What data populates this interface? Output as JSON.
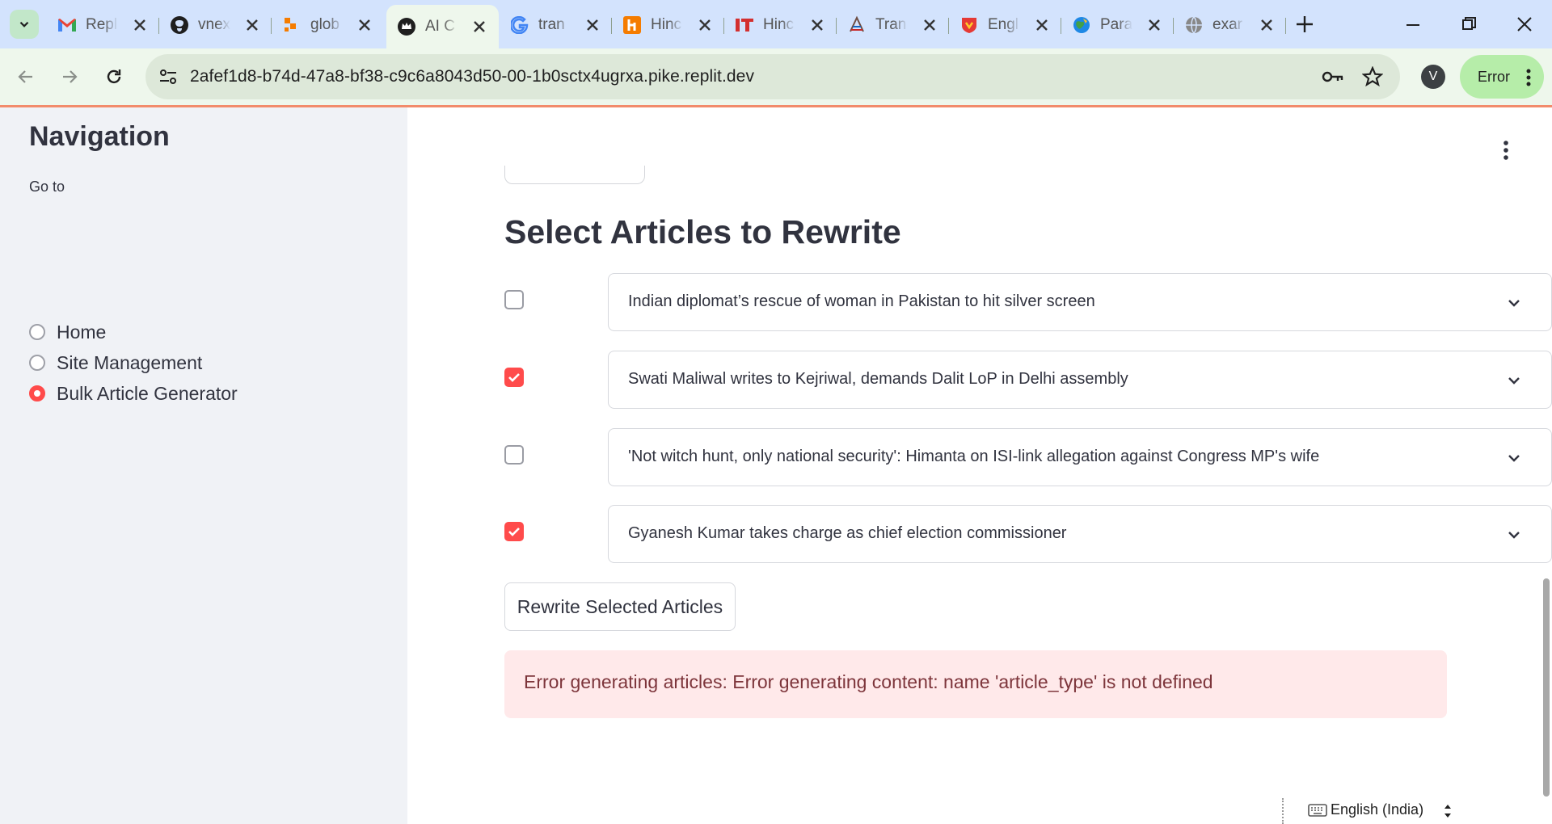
{
  "browser": {
    "tabs": [
      {
        "title": "Repl",
        "icon": "gmail-icon"
      },
      {
        "title": "vnex",
        "icon": "github-icon"
      },
      {
        "title": "glob",
        "icon": "orange-logo-icon"
      },
      {
        "title": "AI C",
        "icon": "crown-icon",
        "active": true
      },
      {
        "title": "tran",
        "icon": "google-icon"
      },
      {
        "title": "Hinc",
        "icon": "hindi-h-icon"
      },
      {
        "title": "Hinc",
        "icon": "it-logo-icon"
      },
      {
        "title": "Tran",
        "icon": "translate-icon"
      },
      {
        "title": "Engl",
        "icon": "shield-logo-icon"
      },
      {
        "title": "Para",
        "icon": "globe-map-icon"
      },
      {
        "title": "exar",
        "icon": "world-icon"
      }
    ],
    "url": "2afef1d8-b74d-47a8-bf38-c9c6a8043d50-00-1b0sctx4ugrxa.pike.replit.dev",
    "profile_initial": "V",
    "status_label": "Error"
  },
  "sidebar": {
    "title": "Navigation",
    "label": "Go to",
    "options": [
      {
        "label": "Home",
        "selected": false
      },
      {
        "label": "Site Management",
        "selected": false
      },
      {
        "label": "Bulk Article Generator",
        "selected": true
      }
    ]
  },
  "main": {
    "heading": "Select Articles to Rewrite",
    "articles": [
      {
        "title": "Indian diplomat’s rescue of woman in Pakistan to hit silver screen",
        "checked": false
      },
      {
        "title": "Swati Maliwal writes to Kejriwal, demands Dalit LoP in Delhi assembly",
        "checked": true
      },
      {
        "title": "'Not witch hunt, only national security': Himanta on ISI-link allegation against Congress MP's wife",
        "checked": false
      },
      {
        "title": "Gyanesh Kumar takes charge as chief election commissioner",
        "checked": true
      }
    ],
    "rewrite_button": "Rewrite Selected Articles",
    "error_message": "Error generating articles: Error generating content: name 'article_type' is not defined"
  },
  "taskbar": {
    "input_language": "English (India)"
  },
  "colors": {
    "accent": "#ff4b4b",
    "sidebar_bg": "#f0f2f6",
    "error_bg": "#ffe9ea",
    "error_text": "#7d353b",
    "chrome_tab_bg": "#d3e3fd"
  }
}
